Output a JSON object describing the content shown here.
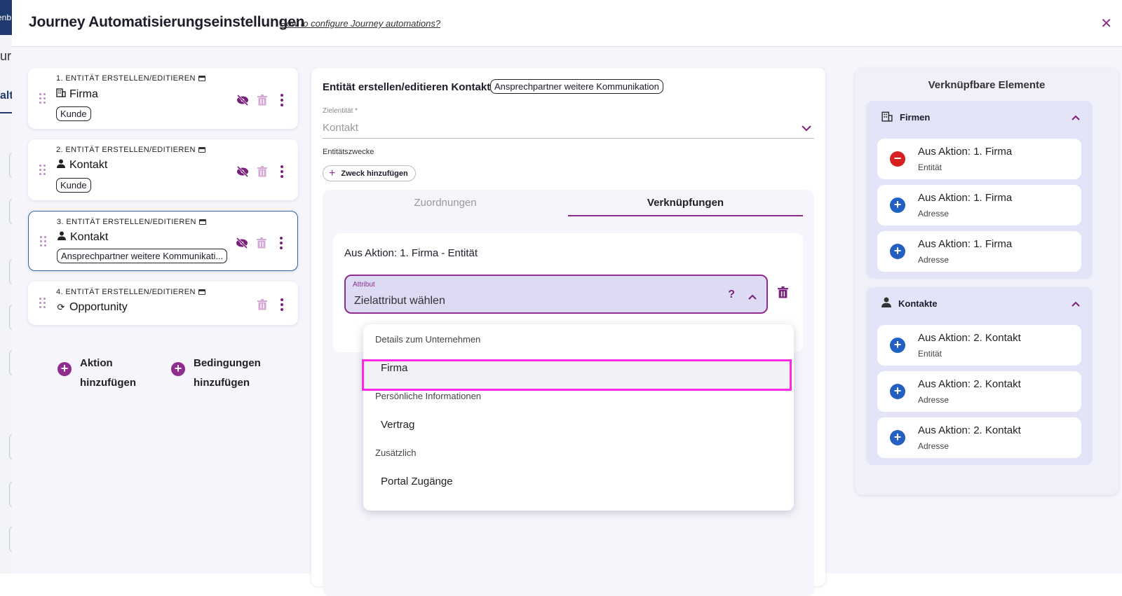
{
  "background_app": {
    "nav_text": "enb",
    "letters": "ur",
    "tab": "alt"
  },
  "modal": {
    "title": "Journey Automatisierungseinstellungen",
    "help_link": "How to configure Journey automations?",
    "close_icon": "close-icon"
  },
  "actions": [
    {
      "heading": "1. Entität erstellen/editieren",
      "name": "Firma",
      "icon": "building-icon",
      "tag": "Kunde"
    },
    {
      "heading": "2. Entität erstellen/editieren",
      "name": "Kontakt",
      "icon": "person-icon",
      "tag": "Kunde"
    },
    {
      "heading": "3. Entität erstellen/editieren",
      "name": "Kontakt",
      "icon": "person-icon",
      "tag": "Ansprechpartner weitere Kommunikati..."
    },
    {
      "heading": "4. Entität erstellen/editieren",
      "name": "Opportunity",
      "icon": "refresh-icon",
      "tag": ""
    }
  ],
  "add_buttons": {
    "action": [
      "Aktion",
      "hinzufügen"
    ],
    "condition": [
      "Bedingungen",
      "hinzufügen"
    ]
  },
  "editor": {
    "title": "Entität erstellen/editieren Kontakt",
    "purpose_tag": "Ansprechpartner weitere Kommunikation",
    "target_label": "Zielentität *",
    "target_value": "Kontakt",
    "purposes_label": "Entitätszwecke",
    "add_purpose": "Zweck hinzufügen",
    "tabs": {
      "assignments": "Zuordnungen",
      "links": "Verknüpfungen",
      "active": "links"
    },
    "mapping": {
      "title": "Aus Aktion: 1. Firma - Entität",
      "attribute_label": "Attribut",
      "attribute_value": "Zielattribut wählen",
      "help": "?"
    }
  },
  "dropdown": {
    "groups": [
      {
        "label": "Details zum Unternehmen",
        "items": [
          "Firma"
        ]
      },
      {
        "label": "Persönliche Informationen",
        "items": [
          "Vertrag"
        ]
      },
      {
        "label": "Zusätzlich",
        "items": [
          "Portal Zugänge"
        ]
      }
    ],
    "highlighted": "Firma"
  },
  "linkable": {
    "title": "Verknüpfbare Elemente",
    "groups": [
      {
        "name": "Firmen",
        "icon": "building-icon",
        "items": [
          {
            "title": "Aus Aktion: 1. Firma",
            "sub": "Entität",
            "state": "remove"
          },
          {
            "title": "Aus Aktion: 1. Firma",
            "sub": "Adresse",
            "state": "add"
          },
          {
            "title": "Aus Aktion: 1. Firma",
            "sub": "Adresse",
            "state": "add"
          }
        ]
      },
      {
        "name": "Kontakte",
        "icon": "person-icon",
        "items": [
          {
            "title": "Aus Aktion: 2. Kontakt",
            "sub": "Entität",
            "state": "add"
          },
          {
            "title": "Aus Aktion: 2. Kontakt",
            "sub": "Adresse",
            "state": "add"
          },
          {
            "title": "Aus Aktion: 2. Kontakt",
            "sub": "Adresse",
            "state": "add"
          }
        ]
      }
    ]
  },
  "colors": {
    "accent": "#8f2d8f",
    "add": "#2460c2",
    "remove": "#d72020",
    "highlight": "#ff27e8"
  }
}
